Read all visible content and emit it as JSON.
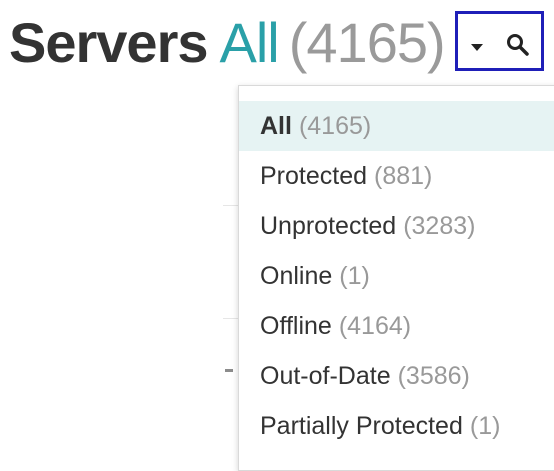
{
  "header": {
    "title": "Servers",
    "filter_name": "All",
    "filter_count": "(4165)"
  },
  "filter_menu": {
    "items": [
      {
        "label": "All",
        "count": "(4165)",
        "selected": true
      },
      {
        "label": "Protected",
        "count": "(881)",
        "selected": false
      },
      {
        "label": "Unprotected",
        "count": "(3283)",
        "selected": false
      },
      {
        "label": "Online",
        "count": "(1)",
        "selected": false
      },
      {
        "label": "Offline",
        "count": "(4164)",
        "selected": false
      },
      {
        "label": "Out-of-Date",
        "count": "(3586)",
        "selected": false
      },
      {
        "label": "Partially Protected",
        "count": "(1)",
        "selected": false
      }
    ]
  },
  "icons": {
    "dropdown": "caret-down-icon",
    "search": "search-icon"
  },
  "colors": {
    "title": "#333333",
    "accent": "#2aa0a8",
    "count": "#9a9a9a",
    "focus_border": "#1f1fb8",
    "selected_bg": "#e6f3f3"
  }
}
